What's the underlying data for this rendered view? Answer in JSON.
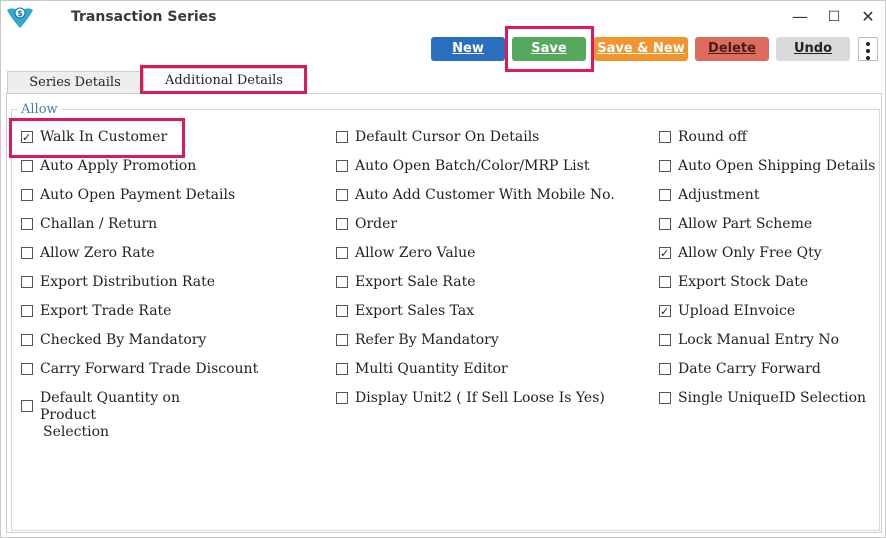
{
  "window": {
    "title": "Transaction Series",
    "controls": {
      "minimize": "—",
      "maximize": "☐",
      "close": "✕"
    }
  },
  "toolbar": {
    "new_label": "New",
    "save_label": "Save",
    "save_new_label": "Save & New",
    "delete_label": "Delete",
    "undo_label": "Undo",
    "colors": {
      "new": "#2a6ebf",
      "save": "#55a95c",
      "save_new": "#f5932f",
      "delete": "#dd6b5e",
      "undo": "#d9d9d9",
      "highlight": "#e0175c"
    }
  },
  "tabs": [
    {
      "label": "Series Details",
      "active": false
    },
    {
      "label": "Additional Details",
      "active": true
    }
  ],
  "group": {
    "label": "Allow",
    "columns": [
      [
        {
          "label": "Walk In Customer",
          "checked": true
        },
        {
          "label": "Auto Apply Promotion",
          "checked": false
        },
        {
          "label": "Auto Open Payment Details",
          "checked": false
        },
        {
          "label": "Challan / Return",
          "checked": false
        },
        {
          "label": "Allow Zero Rate",
          "checked": false
        },
        {
          "label": "Export Distribution Rate",
          "checked": false
        },
        {
          "label": "Export Trade Rate",
          "checked": false
        },
        {
          "label": "Checked By Mandatory",
          "checked": false
        },
        {
          "label": "Carry Forward Trade Discount",
          "checked": false
        },
        {
          "label": "Default Quantity on Product Selection",
          "checked": false
        }
      ],
      [
        {
          "label": "Default Cursor On Details",
          "checked": false
        },
        {
          "label": "Auto Open Batch/Color/MRP List",
          "checked": false
        },
        {
          "label": "Auto Add Customer With Mobile No.",
          "checked": false
        },
        {
          "label": "Order",
          "checked": false
        },
        {
          "label": "Allow Zero Value",
          "checked": false
        },
        {
          "label": "Export Sale Rate",
          "checked": false
        },
        {
          "label": "Export Sales Tax",
          "checked": false
        },
        {
          "label": "Refer By Mandatory",
          "checked": false
        },
        {
          "label": "Multi Quantity Editor",
          "checked": false
        },
        {
          "label": "Display Unit2 ( If Sell Loose Is Yes)",
          "checked": false
        }
      ],
      [
        {
          "label": "Round off",
          "checked": false
        },
        {
          "label": "Auto Open Shipping Details",
          "checked": false
        },
        {
          "label": "Adjustment",
          "checked": false
        },
        {
          "label": "Allow Part Scheme",
          "checked": false
        },
        {
          "label": "Allow Only Free Qty",
          "checked": true
        },
        {
          "label": "Export Stock Date",
          "checked": false
        },
        {
          "label": "Upload EInvoice",
          "checked": true
        },
        {
          "label": "Lock Manual Entry No",
          "checked": false
        },
        {
          "label": "Date Carry Forward",
          "checked": false
        },
        {
          "label": "Single UniqueID Selection",
          "checked": false
        }
      ]
    ]
  }
}
